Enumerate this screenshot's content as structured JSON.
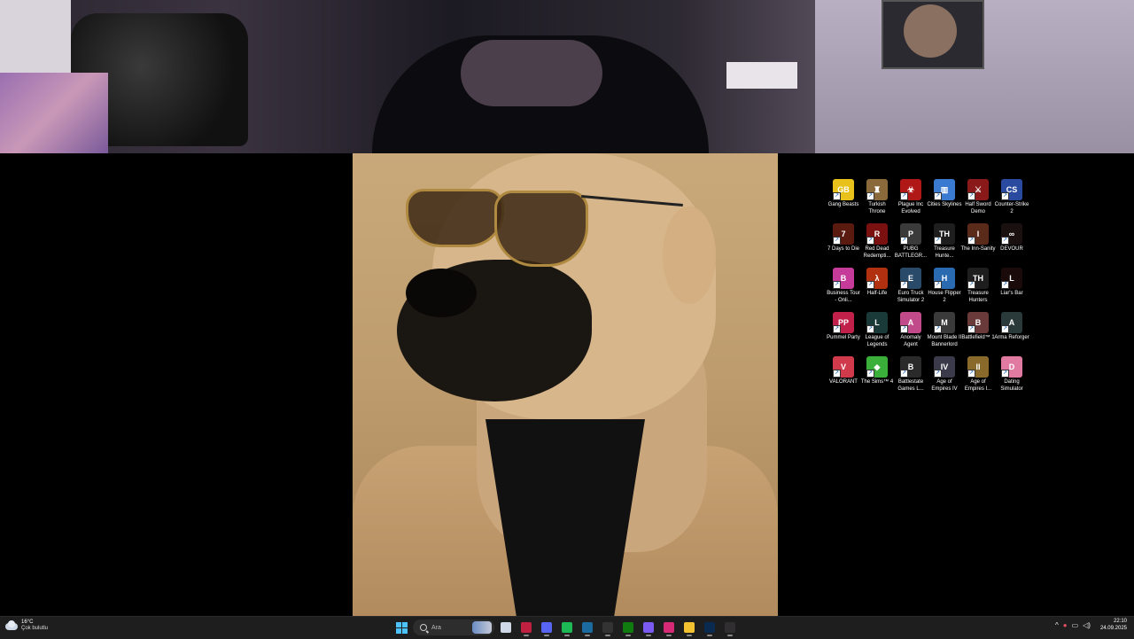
{
  "desktop": {
    "icons": [
      {
        "label": "Gang Beasts",
        "color": "#e8c21a",
        "glyph": "GB"
      },
      {
        "label": "Turkish Throne",
        "color": "#8a6a3a",
        "glyph": "♜"
      },
      {
        "label": "Plague Inc Evolved",
        "color": "#b01818",
        "glyph": "☣"
      },
      {
        "label": "Cities Skylines",
        "color": "#3a7ad0",
        "glyph": "▥"
      },
      {
        "label": "Half Sword Demo",
        "color": "#8a1a1a",
        "glyph": "⚔"
      },
      {
        "label": "Counter-Strike 2",
        "color": "#2a4aa0",
        "glyph": "CS"
      },
      {
        "label": "7 Days to Die",
        "color": "#5a1a10",
        "glyph": "7"
      },
      {
        "label": "Red Dead Redempti...",
        "color": "#7a1010",
        "glyph": "R"
      },
      {
        "label": "PUBG BATTLEGR...",
        "color": "#3a3a3a",
        "glyph": "P"
      },
      {
        "label": "Treasure Hunte...",
        "color": "#1e1e1e",
        "glyph": "TH"
      },
      {
        "label": "The Inn-Sanity",
        "color": "#5a2a1a",
        "glyph": "I"
      },
      {
        "label": "DEVOUR",
        "color": "#1a1010",
        "glyph": "∞"
      },
      {
        "label": "Business Tour - Onli...",
        "color": "#c63a9a",
        "glyph": "B"
      },
      {
        "label": "Half-Life",
        "color": "#b03010",
        "glyph": "λ"
      },
      {
        "label": "Euro Truck Simulator 2",
        "color": "#2a4a6a",
        "glyph": "E"
      },
      {
        "label": "House Flipper 2",
        "color": "#2a6ab0",
        "glyph": "H"
      },
      {
        "label": "Treasure Hunters",
        "color": "#1e1e1e",
        "glyph": "TH"
      },
      {
        "label": "Liar's Bar",
        "color": "#1a0a0a",
        "glyph": "L"
      },
      {
        "label": "Pummel Party",
        "color": "#c0204a",
        "glyph": "PP"
      },
      {
        "label": "League of Legends",
        "color": "#1a3a3a",
        "glyph": "L"
      },
      {
        "label": "Anomaly Agent",
        "color": "#c04a8a",
        "glyph": "A"
      },
      {
        "label": "Mount  Blade II Bannerlord",
        "color": "#3a3a3a",
        "glyph": "M"
      },
      {
        "label": "Battlefield™ 1",
        "color": "#6a3a3a",
        "glyph": "B"
      },
      {
        "label": "Arma Reforger",
        "color": "#2a3a3a",
        "glyph": "A"
      },
      {
        "label": "VALORANT",
        "color": "#d03a4a",
        "glyph": "V"
      },
      {
        "label": "The Sims™ 4",
        "color": "#3ab03a",
        "glyph": "◆"
      },
      {
        "label": "Battlestate Games L...",
        "color": "#2a2a2a",
        "glyph": "B"
      },
      {
        "label": "Age of Empires IV",
        "color": "#3a3a4a",
        "glyph": "IV"
      },
      {
        "label": "Age of Empires I...",
        "color": "#8a6a2a",
        "glyph": "II"
      },
      {
        "label": "Dating Simulator",
        "color": "#e07aa0",
        "glyph": "D"
      }
    ]
  },
  "taskbar": {
    "weather": {
      "temp": "16°C",
      "desc": "Çok bulutlu"
    },
    "search": {
      "placeholder": "Ara"
    },
    "apps": [
      {
        "name": "task-view",
        "color": "#cfd8e6"
      },
      {
        "name": "fan-app",
        "color": "#c02040"
      },
      {
        "name": "discord",
        "color": "#5865f2"
      },
      {
        "name": "spotify",
        "color": "#1db954"
      },
      {
        "name": "steam",
        "color": "#1b6aa0"
      },
      {
        "name": "epic-games",
        "color": "#333"
      },
      {
        "name": "xbox",
        "color": "#107c10"
      },
      {
        "name": "copilot",
        "color": "#7a5af0"
      },
      {
        "name": "instagram",
        "color": "#d62976"
      },
      {
        "name": "file-explorer",
        "color": "#f2c230"
      },
      {
        "name": "photoshop",
        "color": "#0a2a50"
      },
      {
        "name": "obs",
        "color": "#302e31"
      }
    ],
    "clock": {
      "time": "22:10",
      "date": "24.09.2025"
    }
  }
}
